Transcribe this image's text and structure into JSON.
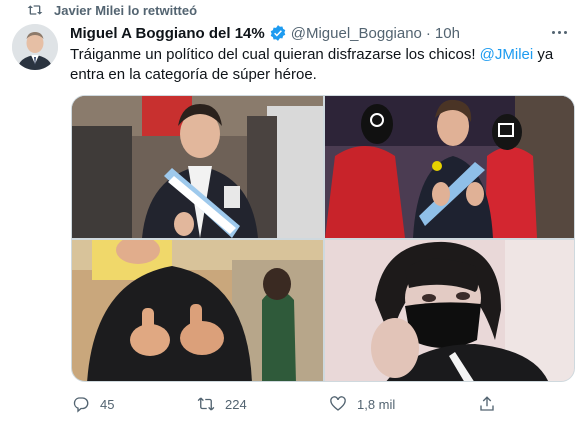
{
  "retweet_context": {
    "text": "Javier Milei lo retwitteó",
    "icon": "retweet-icon"
  },
  "author": {
    "display_name": "Miguel A Boggiano del 14%",
    "handle": "@Miguel_Boggiano",
    "separator": "·",
    "time": "10h",
    "verified": true,
    "avatar_icon": "avatar-photo"
  },
  "tweet": {
    "text_before_mention": "Tráiganme un político del cual quieran disfrazarse los chicos! ",
    "mention": "@JMilei",
    "text_after_mention": " ya entra en la categoría de súper héroe."
  },
  "media": [
    {
      "alt": "photo-1"
    },
    {
      "alt": "photo-2"
    },
    {
      "alt": "photo-3"
    },
    {
      "alt": "photo-4"
    }
  ],
  "actions": {
    "reply": {
      "icon": "reply-icon",
      "count": "45"
    },
    "retweet": {
      "icon": "retweet-icon",
      "count": "224"
    },
    "like": {
      "icon": "heart-icon",
      "count": "1,8 mil"
    },
    "share": {
      "icon": "share-icon",
      "count": ""
    }
  },
  "colors": {
    "accent": "#1d9bf0",
    "text": "#0f1419",
    "secondary": "#536471"
  }
}
